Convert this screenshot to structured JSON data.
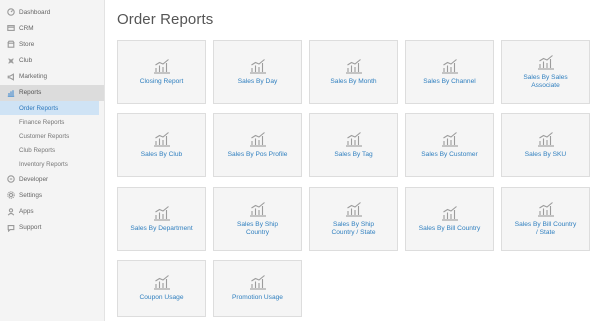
{
  "sidebar": {
    "items": [
      {
        "label": "Dashboard",
        "icon": "dashboard-icon"
      },
      {
        "label": "CRM",
        "icon": "crm-icon"
      },
      {
        "label": "Store",
        "icon": "store-icon"
      },
      {
        "label": "Club",
        "icon": "club-icon"
      },
      {
        "label": "Marketing",
        "icon": "megaphone-icon"
      },
      {
        "label": "Reports",
        "icon": "bar-chart-icon"
      }
    ],
    "sub_items": [
      {
        "label": "Order Reports"
      },
      {
        "label": "Finance Reports"
      },
      {
        "label": "Customer Reports"
      },
      {
        "label": "Club Reports"
      },
      {
        "label": "Inventory Reports"
      }
    ],
    "bottom_items": [
      {
        "label": "Developer",
        "icon": "developer-icon"
      },
      {
        "label": "Settings",
        "icon": "gear-icon"
      },
      {
        "label": "Apps",
        "icon": "apps-icon"
      },
      {
        "label": "Support",
        "icon": "support-icon"
      }
    ]
  },
  "main": {
    "title": "Order Reports",
    "cards": [
      {
        "label": "Closing Report"
      },
      {
        "label": "Sales By Day"
      },
      {
        "label": "Sales By Month"
      },
      {
        "label": "Sales By Channel"
      },
      {
        "label": "Sales By Sales Associate"
      },
      {
        "label": "Sales By Club"
      },
      {
        "label": "Sales By Pos Profile"
      },
      {
        "label": "Sales By Tag"
      },
      {
        "label": "Sales By Customer"
      },
      {
        "label": "Sales By SKU"
      },
      {
        "label": "Sales By Department"
      },
      {
        "label": "Sales By Ship Country"
      },
      {
        "label": "Sales By Ship Country / State"
      },
      {
        "label": "Sales By Bill Country"
      },
      {
        "label": "Sales By Bill Country / State"
      },
      {
        "label": "Coupon Usage"
      },
      {
        "label": "Promotion Usage"
      }
    ]
  },
  "colors": {
    "accent": "#2f7fbf",
    "sidebar_bg": "#f4f4f4",
    "active_item_bg": "#dcdcdc",
    "selected_sub_bg": "#cfe3f5",
    "card_bg": "#f5f5f5"
  }
}
